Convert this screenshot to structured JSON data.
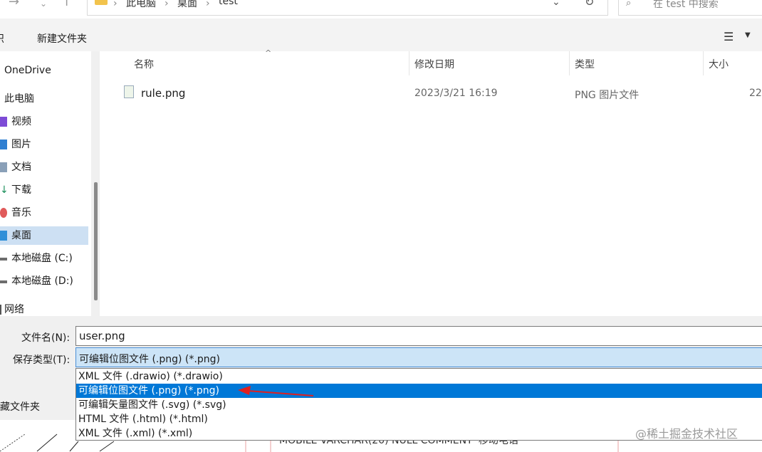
{
  "address": {
    "crumbs": [
      "此电脑",
      "桌面",
      "test"
    ],
    "search_placeholder": "在 test 中搜索"
  },
  "toolbar": {
    "left_fragment": "织",
    "new_folder": "新建文件夹"
  },
  "sidebar": {
    "items": [
      {
        "label": "OneDrive",
        "icon": "cloud-icon"
      },
      {
        "label": "此电脑",
        "icon": "computer-icon"
      },
      {
        "label": "视频",
        "icon": "video-icon"
      },
      {
        "label": "图片",
        "icon": "picture-icon"
      },
      {
        "label": "文档",
        "icon": "document-icon"
      },
      {
        "label": "下载",
        "icon": "download-icon"
      },
      {
        "label": "音乐",
        "icon": "music-icon"
      },
      {
        "label": "桌面",
        "icon": "desktop-icon",
        "selected": true
      },
      {
        "label": "本地磁盘 (C:)",
        "icon": "drive-icon"
      },
      {
        "label": "本地磁盘 (D:)",
        "icon": "drive-icon"
      },
      {
        "label": "网络",
        "icon": "network-icon"
      }
    ]
  },
  "filelist": {
    "headers": [
      "名称",
      "修改日期",
      "类型",
      "大小"
    ],
    "rows": [
      {
        "name": "rule.png",
        "date": "2023/3/21 16:19",
        "type": "PNG 图片文件",
        "size": "22"
      }
    ]
  },
  "form": {
    "filename_label": "文件名(N):",
    "filename_value": "user.png",
    "filetype_label": "保存类型(T):",
    "filetype_value": "可编辑位图文件 (.png) (*.png)",
    "hide_folders": "藏文件夹",
    "options": [
      "XML 文件 (.drawio) (*.drawio)",
      "可编辑位图文件 (.png) (*.png)",
      "可编辑矢量图文件 (.svg) (*.svg)",
      "HTML 文件 (.html) (*.html)",
      "XML 文件 (.xml) (*.xml)"
    ],
    "highlighted_index": 1
  },
  "background_text": "MOBILE VARCHAR(20) NULL COMMENT '移动电话'",
  "watermark": "@稀土掘金技术社区",
  "colors": {
    "accent": "#0078d7",
    "selection": "#cde0f3",
    "arrow": "#e02020"
  }
}
